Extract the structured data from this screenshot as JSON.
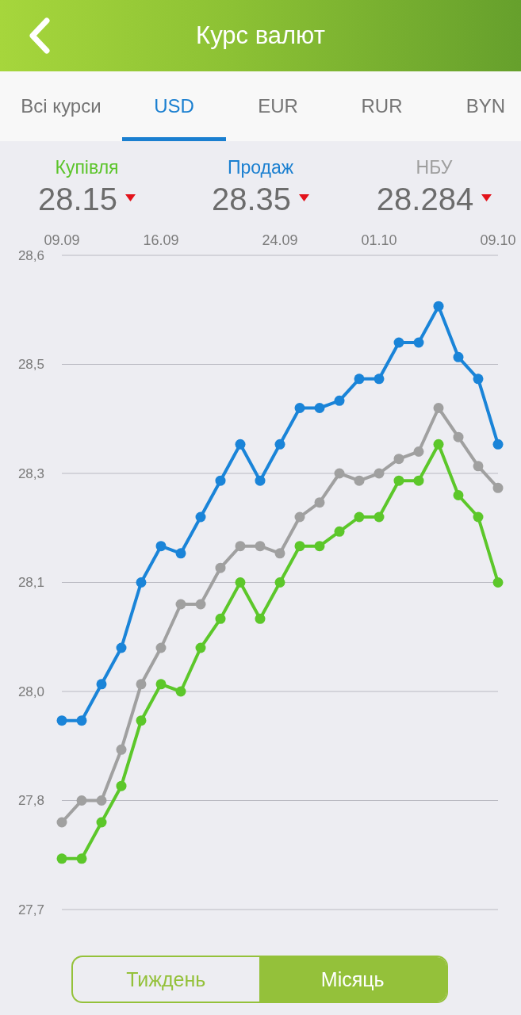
{
  "header": {
    "title": "Курс валют"
  },
  "tabs": [
    {
      "label": "Всі курси",
      "selected": false
    },
    {
      "label": "USD",
      "selected": true
    },
    {
      "label": "EUR",
      "selected": false
    },
    {
      "label": "RUR",
      "selected": false
    },
    {
      "label": "BYN",
      "selected": false
    }
  ],
  "rates": [
    {
      "label": "Купівля",
      "color": "#5bc42a",
      "value": "28.15",
      "falling": true
    },
    {
      "label": "Продаж",
      "color": "#1a7fd0",
      "value": "28.35",
      "falling": true
    },
    {
      "label": "НБУ",
      "color": "#9e9e9e",
      "value": "28.284",
      "falling": true
    }
  ],
  "chart": {
    "chart_data": {
      "type": "line",
      "grid": true,
      "categories": [
        "09.09",
        null,
        null,
        null,
        null,
        "16.09",
        null,
        null,
        null,
        null,
        null,
        "24.09",
        null,
        null,
        null,
        null,
        "01.10",
        null,
        null,
        null,
        null,
        null,
        "09.10"
      ],
      "ylim": [
        27.7,
        28.6
      ],
      "yticks": [
        {
          "value": 27.7,
          "label": "27,7"
        },
        {
          "value": 27.85,
          "label": "27,8"
        },
        {
          "value": 28,
          "label": "28,0"
        },
        {
          "value": 28.15,
          "label": "28,1"
        },
        {
          "value": 28.3,
          "label": "28,3"
        },
        {
          "value": 28.45,
          "label": "28,5"
        },
        {
          "value": 28.6,
          "label": "28,6"
        }
      ],
      "series": [
        {
          "color": "#1a84d8",
          "marker": "circle",
          "values": [
            27.96,
            27.96,
            28.01,
            28.06,
            28.15,
            28.2,
            28.19,
            28.24,
            28.29,
            28.34,
            28.29,
            28.34,
            28.39,
            28.39,
            28.4,
            28.43,
            28.43,
            28.48,
            28.48,
            28.53,
            28.46,
            28.43,
            28.34
          ]
        },
        {
          "color": "#a0a0a0",
          "marker": "circle",
          "values": [
            27.82,
            27.85,
            27.85,
            27.92,
            28.01,
            28.06,
            28.12,
            28.12,
            28.17,
            28.2,
            28.2,
            28.19,
            28.24,
            28.26,
            28.3,
            28.29,
            28.3,
            28.32,
            28.33,
            28.39,
            28.35,
            28.31,
            28.28
          ]
        },
        {
          "color": "#5cc72a",
          "marker": "circle",
          "values": [
            27.77,
            27.77,
            27.82,
            27.87,
            27.96,
            28.01,
            28.0,
            28.06,
            28.1,
            28.15,
            28.1,
            28.15,
            28.2,
            28.2,
            28.22,
            28.24,
            28.24,
            28.29,
            28.29,
            28.34,
            28.27,
            28.24,
            28.15
          ]
        }
      ]
    }
  },
  "periods": [
    {
      "label": "Тиждень",
      "selected": false
    },
    {
      "label": "Місяць",
      "selected": true
    }
  ]
}
